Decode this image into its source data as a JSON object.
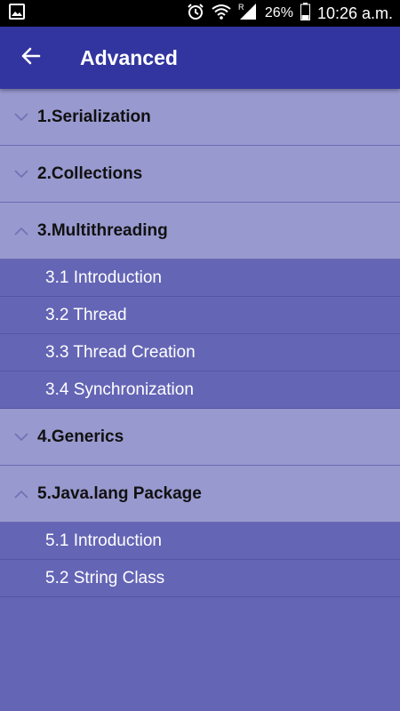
{
  "status_bar": {
    "battery": "26%",
    "time": "10:26 a.m."
  },
  "app_bar": {
    "title": "Advanced"
  },
  "groups": [
    {
      "label": "1.Serialization",
      "expanded": false,
      "children": []
    },
    {
      "label": "2.Collections",
      "expanded": false,
      "children": []
    },
    {
      "label": "3.Multithreading",
      "expanded": true,
      "children": [
        "3.1 Introduction",
        "3.2 Thread",
        "3.3 Thread Creation",
        "3.4 Synchronization"
      ]
    },
    {
      "label": "4.Generics",
      "expanded": false,
      "children": []
    },
    {
      "label": "5.Java.lang Package",
      "expanded": true,
      "children": [
        "5.1 Introduction",
        "5.2 String Class"
      ]
    }
  ],
  "colors": {
    "app_bar": "#3235a0",
    "group_header": "#9899cf",
    "child_bg": "#6465b5"
  }
}
